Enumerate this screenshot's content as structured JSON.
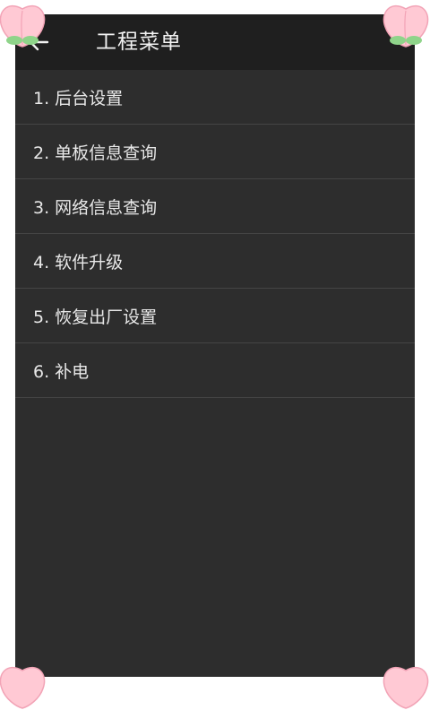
{
  "header": {
    "title": "工程菜单",
    "back_icon": "back-arrow-icon"
  },
  "menu": {
    "items": [
      {
        "label": "1. 后台设置"
      },
      {
        "label": "2. 单板信息查询"
      },
      {
        "label": "3. 网络信息查询"
      },
      {
        "label": "4. 软件升级"
      },
      {
        "label": "5. 恢复出厂设置"
      },
      {
        "label": "6. 补电"
      }
    ]
  },
  "colors": {
    "background": "#2d2d2d",
    "toolbar": "#1f1f1f",
    "divider": "#454545",
    "text": "#e8e8e8",
    "sticker_peach": "#ffc9d4",
    "sticker_leaf": "#8fd48a"
  }
}
